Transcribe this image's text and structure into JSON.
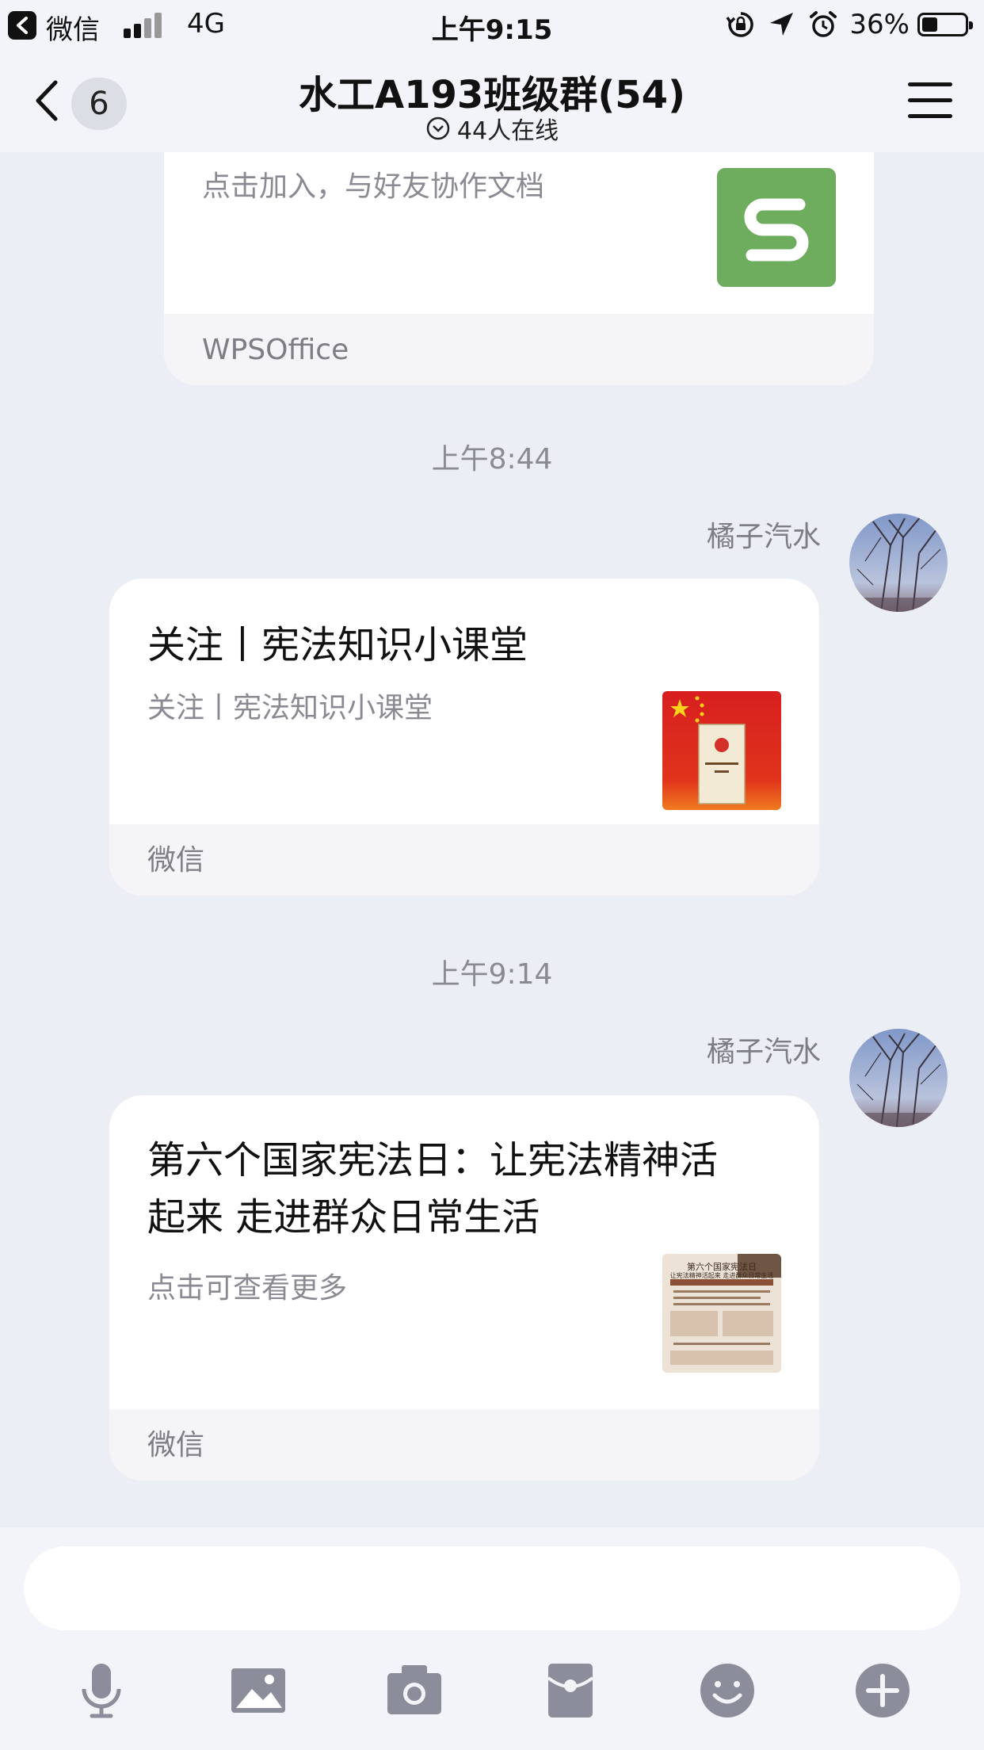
{
  "status_bar": {
    "app": "微信",
    "network": "4G",
    "time": "上午9:15",
    "battery": "36%",
    "battery_level": 0.36
  },
  "nav": {
    "unread_count": "6",
    "title": "水工A193班级群(54)",
    "online": "44人在线"
  },
  "messages": {
    "wps_card": {
      "desc": "点击加入，与好友协作文档",
      "source": "WPSOffice",
      "icon_letter": "S"
    },
    "time1": "上午8:44",
    "msg1": {
      "sender": "橘子汽水",
      "title": "关注丨宪法知识小课堂",
      "desc": "关注丨宪法知识小课堂",
      "source": "微信",
      "thumb_text": "中华人民共和国\n宪 法"
    },
    "time2": "上午9:14",
    "msg2": {
      "sender": "橘子汽水",
      "title_line1": "第六个国家宪法日：让宪法精神活",
      "title_line2": "起来 走进群众日常生活",
      "desc": "点击可查看更多",
      "source": "微信",
      "thumb_title": "第六个国家宪法日",
      "thumb_sub": "让宪法精神活起来 走进群众日常生活"
    }
  },
  "input": {
    "placeholder": ""
  },
  "toolbar": [
    "microphone-icon",
    "image-icon",
    "camera-icon",
    "red-packet-icon",
    "emoji-icon",
    "plus-icon"
  ],
  "colors": {
    "background": "#eceef5",
    "bar": "#f3f4f9",
    "wps_green": "#6fad5e",
    "toolbar_icon": "#8b8d9b"
  }
}
